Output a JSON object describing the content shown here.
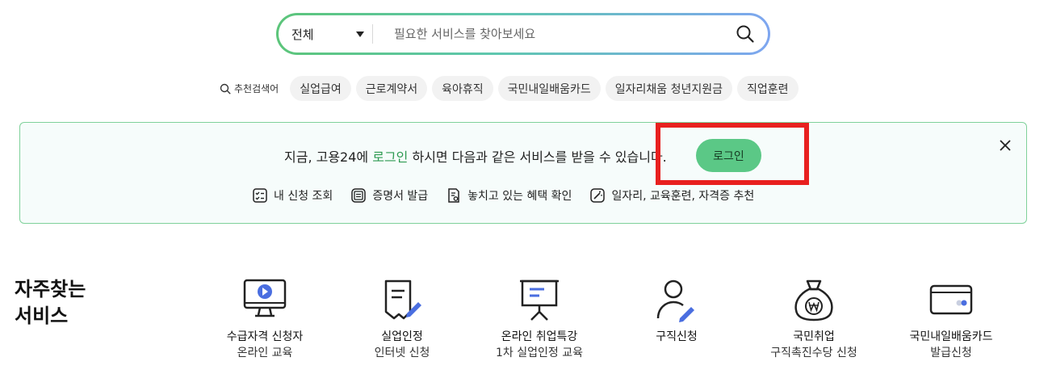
{
  "search": {
    "category": "전체",
    "placeholder": "필요한 서비스를 찾아보세요"
  },
  "recommended": {
    "label": "추천검색어",
    "chips": [
      "실업급여",
      "근로계약서",
      "육아휴직",
      "국민내일배움카드",
      "일자리채움 청년지원금",
      "직업훈련"
    ]
  },
  "banner": {
    "msg_prefix": "지금, 고용24에 ",
    "msg_highlight": "로그인",
    "msg_suffix": " 하시면 다음과 같은 서비스를 받을 수 있습니다.",
    "login_label": "로그인",
    "links": [
      "내 신청 조회",
      "증명서 발급",
      "놓치고 있는 혜택 확인",
      "일자리, 교육훈련, 자격증 추천"
    ]
  },
  "frequent": {
    "title": "자주찾는 서비스",
    "items": [
      {
        "line1": "수급자격 신청자",
        "line2": "온라인 교육",
        "icon": "monitor-play-icon"
      },
      {
        "line1": "실업인정",
        "line2": "인터넷 신청",
        "icon": "document-pen-icon"
      },
      {
        "line1": "온라인 취업특강",
        "line2": "1차 실업인정 교육",
        "icon": "presentation-board-icon"
      },
      {
        "line1": "구직신청",
        "line2": "",
        "icon": "person-pen-icon"
      },
      {
        "line1": "국민취업",
        "line2": "구직촉진수당 신청",
        "icon": "money-bag-won-icon"
      },
      {
        "line1": "국민내일배움카드",
        "line2": "발급신청",
        "icon": "card-icon"
      }
    ]
  },
  "colors": {
    "accent_green": "#5bc886",
    "highlight_text": "#2e9a52",
    "icon_blue": "#4a6ee0",
    "annotation_red": "#e8201f"
  }
}
